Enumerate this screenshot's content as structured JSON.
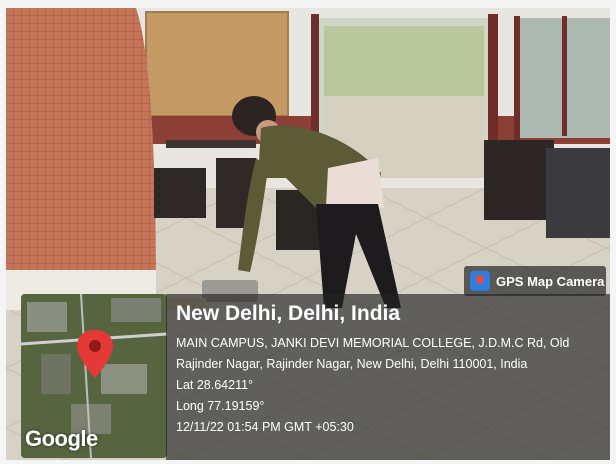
{
  "camera_badge": {
    "label": "GPS Map Camera",
    "icon": "gps-map-camera-icon"
  },
  "map": {
    "logo_text": "Google",
    "pin_color": "#e53935"
  },
  "location": {
    "place": "New Delhi, Delhi, India",
    "address_line1": "MAIN CAMPUS, JANKI DEVI MEMORIAL COLLEGE, J.D.M.C Rd, Old",
    "address_line2": "Rajinder Nagar, Rajinder Nagar, New Delhi, Delhi 110001, India",
    "lat": "Lat 28.64211°",
    "long": "Long 77.19159°",
    "timestamp": "12/11/22 01:54 PM GMT +05:30"
  }
}
